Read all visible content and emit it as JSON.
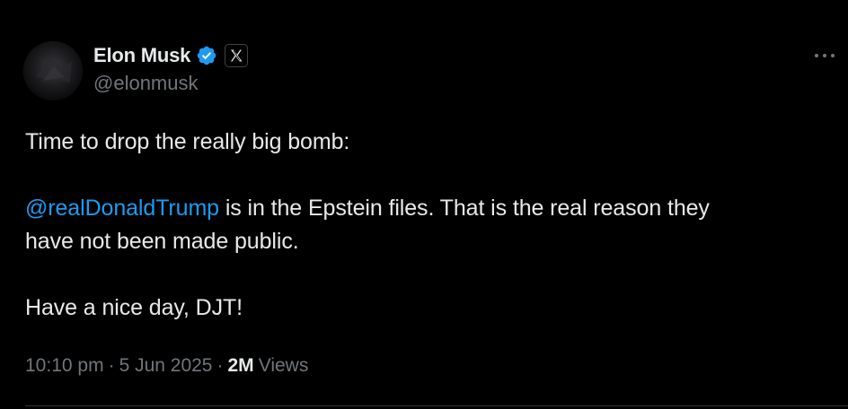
{
  "author": {
    "display_name": "Elon Musk",
    "handle": "@elonmusk",
    "verified_icon": "verified-badge-icon",
    "affiliation_icon": "x-logo-icon"
  },
  "tweet": {
    "line1": "Time to drop the really big bomb:",
    "mention": "@realDonaldTrump",
    "line2_rest": " is in the Epstein files. That is the real reason they",
    "line3": "have not been made public.",
    "line4": "Have a nice day, DJT!"
  },
  "meta": {
    "time": "10:10 pm",
    "separator": "·",
    "date": "5 Jun 2025",
    "views_count": "2M",
    "views_label": "Views"
  },
  "colors": {
    "background": "#000000",
    "text": "#e7e9ea",
    "secondary": "#71767b",
    "link": "#1d9bf0",
    "verified": "#1d9bf0"
  }
}
